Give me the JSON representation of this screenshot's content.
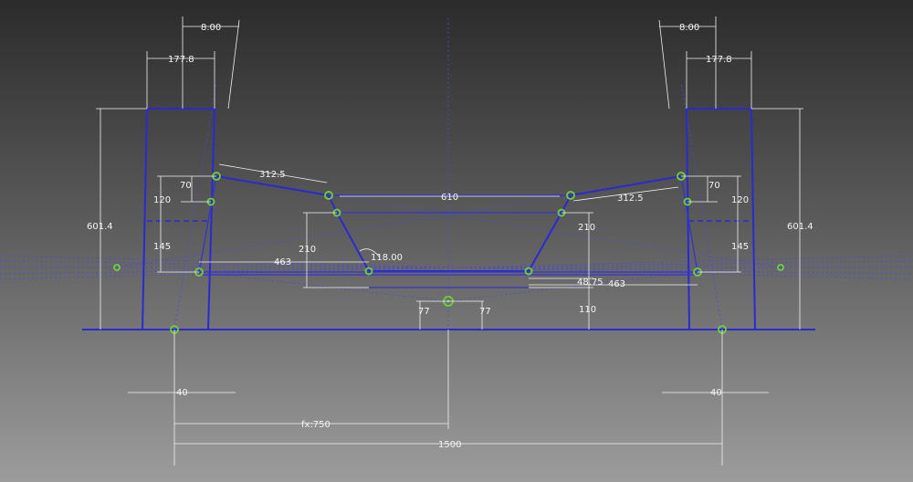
{
  "drawing": {
    "dimensions": {
      "d_8_left": "8.00",
      "d_8_right": "8.00",
      "d_1778_left": "177.8",
      "d_1778_right": "177.8",
      "d_6014_left": "601.4",
      "d_6014_right": "601.4",
      "d_3125_left": "312.5",
      "d_3125_right": "312.5",
      "d_70_left": "70",
      "d_70_right": "70",
      "d_120_left": "120",
      "d_120_right": "120",
      "d_145_left": "145",
      "d_145_right": "145",
      "d_610": "610",
      "d_210_left": "210",
      "d_210_right": "210",
      "d_angle": "118.00",
      "d_463_left": "463",
      "d_463_right": "463",
      "d_4875": "48.75",
      "d_110": "110",
      "d_77_left": "77",
      "d_77_right": "77",
      "d_40_left": "40",
      "d_40_right": "40",
      "d_fx750": "fx:750",
      "d_1500": "1500"
    },
    "colors": {
      "geometry": "#2a2ad0",
      "dimension": "#f2f2f2",
      "constraint_point": "#6ed23a"
    }
  }
}
